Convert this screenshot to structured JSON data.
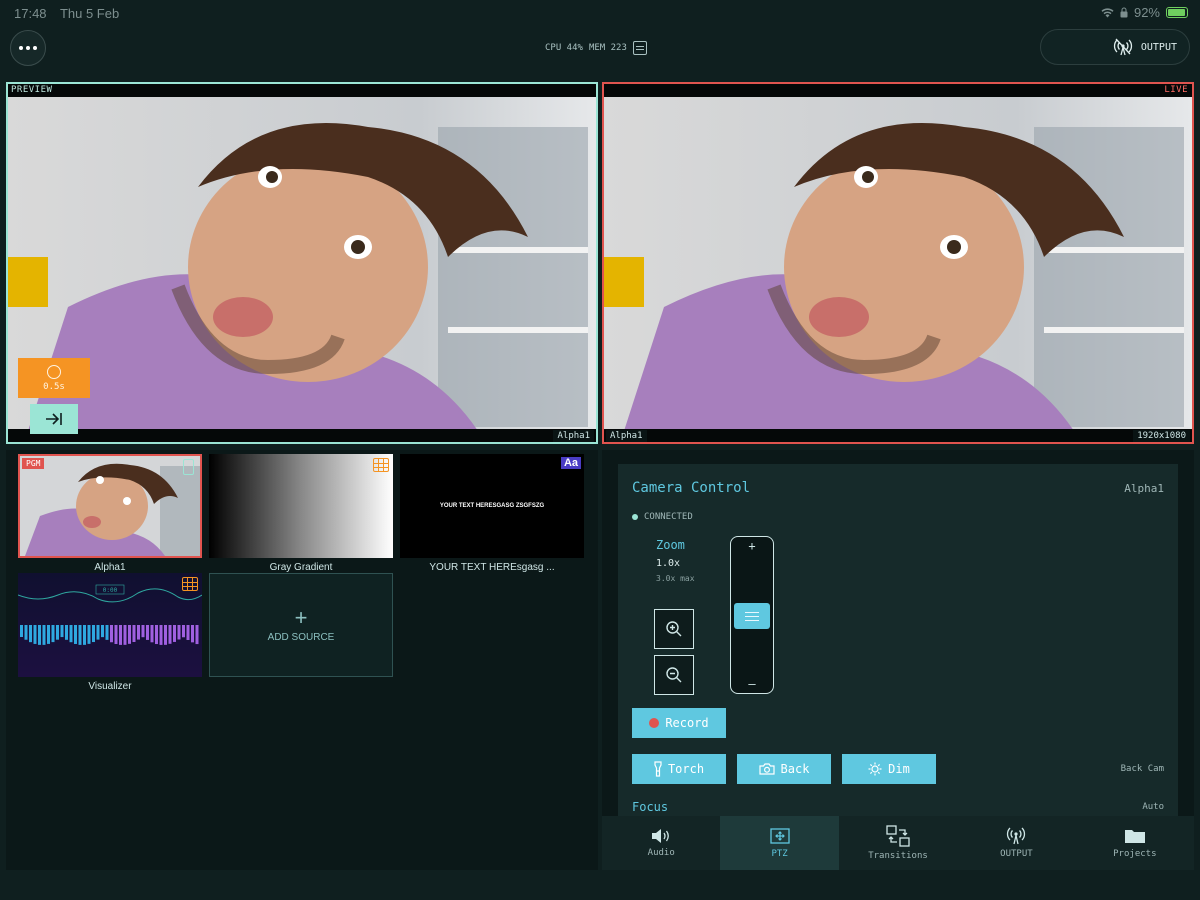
{
  "status_bar": {
    "time": "17:48",
    "date": "Thu 5 Feb",
    "battery": "92%"
  },
  "top_bar": {
    "cpu": "CPU 44%",
    "mem": "MEM 223",
    "output_label": "OUTPUT"
  },
  "preview": {
    "label": "PREVIEW",
    "source": "Alpha1",
    "transition_duration": "0.5s"
  },
  "live": {
    "label": "LIVE",
    "source": "Alpha1",
    "resolution": "1920x1080"
  },
  "sources": {
    "items": [
      {
        "name": "Alpha1",
        "badge": "PGM",
        "type": "camera"
      },
      {
        "name": "Gray Gradient",
        "type": "gradient"
      },
      {
        "name": "YOUR TEXT HEREsgasg ...",
        "type": "text",
        "preview_text": "YOUR TEXT HERESGASG ZSGFSZG",
        "badge": "Aa"
      },
      {
        "name": "Visualizer",
        "type": "visualizer",
        "preview_text": "0:00"
      }
    ],
    "add_label": "ADD SOURCE"
  },
  "camera_control": {
    "title": "Camera Control",
    "camera_name": "Alpha1",
    "status": "CONNECTED",
    "zoom_label": "Zoom",
    "zoom_value": "1.0x",
    "zoom_max": "3.0x max",
    "zoom_level": 0.5,
    "record_label": "Record",
    "torch_label": "Torch",
    "back_label": "Back",
    "dim_label": "Dim",
    "back_cam": "Back Cam",
    "focus_label": "Focus",
    "focus_mode": "Auto"
  },
  "tabs": [
    {
      "label": "Audio",
      "icon": "speaker-icon"
    },
    {
      "label": "PTZ",
      "icon": "ptz-icon",
      "active": true
    },
    {
      "label": "Transitions",
      "icon": "transitions-icon"
    },
    {
      "label": "OUTPUT",
      "icon": "broadcast-icon"
    },
    {
      "label": "Projects",
      "icon": "folder-icon"
    }
  ],
  "colors": {
    "background": "#0f1f1f",
    "accent": "#5fc8e0",
    "preview_border": "#9be5d5",
    "live_border": "#e0544f",
    "transition": "#f59423"
  }
}
